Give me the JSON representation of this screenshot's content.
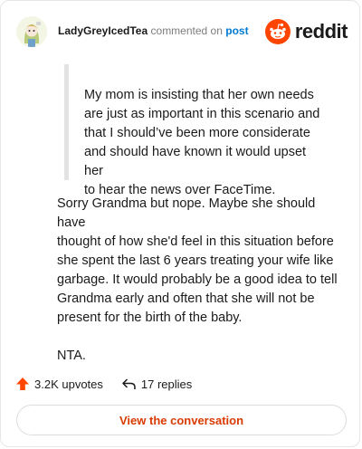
{
  "header": {
    "username": "LadyGreyIcedTea",
    "action_text": "commented on",
    "post_link": "post",
    "brand_name": "reddit"
  },
  "comment": {
    "quote_lines": [
      "My mom is insisting that her own needs",
      "are just as important in this scenario and",
      "that I should’ve been more considerate",
      "and should have known it would upset her",
      "to hear the news over FaceTime."
    ],
    "body_lines": [
      "Sorry Grandma but nope. Maybe she should have",
      "thought of how she'd feel in this situation before",
      "she spent the last 6 years treating your wife like",
      "garbage. It would probably be a good idea to tell",
      "Grandma early and often that she will not be",
      "present for the birth of the baby."
    ],
    "verdict": "NTA."
  },
  "stats": {
    "upvotes_label": "3.2K upvotes",
    "replies_label": "17 replies"
  },
  "cta": {
    "label": "View the conversation"
  },
  "icons": {
    "upvote": "upvote-arrow-icon",
    "reply": "reply-arrow-icon",
    "brand": "reddit-snoo-icon",
    "avatar": "user-avatar"
  },
  "colors": {
    "brand_orange": "#ff4500",
    "link_blue": "#0079d3",
    "cta_text": "#d93a00",
    "upvote": "#ff4500"
  }
}
